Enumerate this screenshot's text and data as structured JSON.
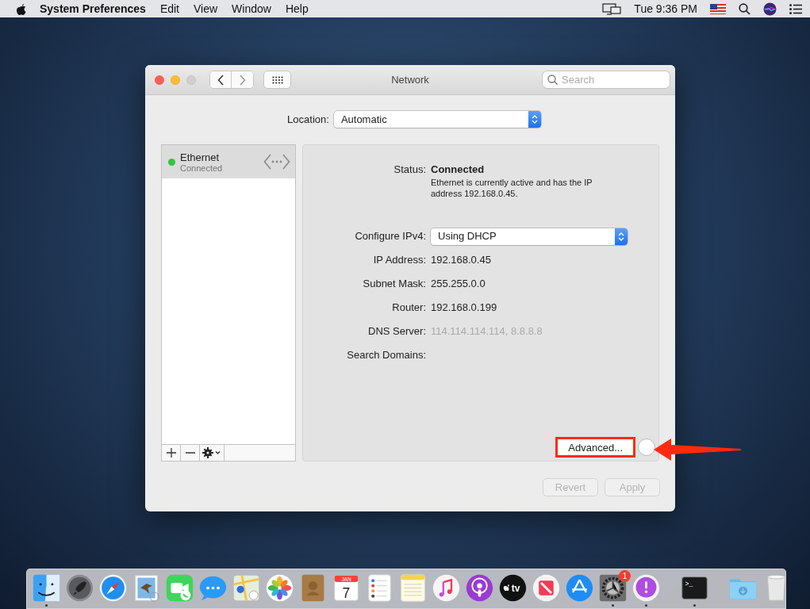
{
  "menubar": {
    "app_name": "System Preferences",
    "menus": [
      "Edit",
      "View",
      "Window",
      "Help"
    ],
    "clock": "Tue 9:36 PM"
  },
  "window": {
    "title": "Network",
    "search": {
      "placeholder": "Search"
    },
    "location": {
      "label": "Location:",
      "value": "Automatic"
    },
    "services": [
      {
        "name": "Ethernet",
        "status": "Connected",
        "color": "#2fc740",
        "selected": true
      }
    ],
    "status": {
      "label": "Status:",
      "value": "Connected",
      "description": "Ethernet is currently active and has the IP address 192.168.0.45."
    },
    "configure": {
      "label": "Configure IPv4:",
      "value": "Using DHCP"
    },
    "fields": [
      {
        "label": "IP Address:",
        "value": "192.168.0.45",
        "dimmed": false
      },
      {
        "label": "Subnet Mask:",
        "value": "255.255.0.0",
        "dimmed": false
      },
      {
        "label": "Router:",
        "value": "192.168.0.199",
        "dimmed": false
      },
      {
        "label": "DNS Server:",
        "value": "114.114.114.114, 8.8.8.8",
        "dimmed": true
      },
      {
        "label": "Search Domains:"
      }
    ],
    "advanced_button": {
      "label": "Advanced...",
      "highlighted": true
    },
    "buttons": [
      {
        "label": "Revert",
        "disabled": true
      },
      {
        "label": "Apply",
        "disabled": true
      }
    ]
  },
  "dock": {
    "items": [
      {
        "kind": "finder",
        "running": true
      },
      {
        "kind": "launchpad",
        "running": false
      },
      {
        "kind": "safari",
        "running": false
      },
      {
        "kind": "mail",
        "running": false
      },
      {
        "kind": "facetime",
        "running": false
      },
      {
        "kind": "messages",
        "running": false
      },
      {
        "kind": "maps",
        "running": false
      },
      {
        "kind": "photos",
        "running": false
      },
      {
        "kind": "contacts",
        "running": false
      },
      {
        "kind": "calendar",
        "running": false,
        "month": "JAN",
        "day": "7"
      },
      {
        "kind": "reminders",
        "running": false
      },
      {
        "kind": "notes",
        "running": false
      },
      {
        "kind": "music",
        "running": false
      },
      {
        "kind": "podcasts",
        "running": false
      },
      {
        "kind": "tv",
        "running": false,
        "text": "tv"
      },
      {
        "kind": "news",
        "running": false
      },
      {
        "kind": "appstore",
        "running": false
      },
      {
        "kind": "sysprefs",
        "running": true,
        "badge": "1"
      },
      {
        "kind": "feedback",
        "running": true
      },
      {
        "kind": "separator"
      },
      {
        "kind": "terminal",
        "running": true,
        "text": ">_"
      },
      {
        "kind": "separator"
      },
      {
        "kind": "downloads",
        "running": false
      },
      {
        "kind": "trash",
        "running": false
      }
    ]
  }
}
